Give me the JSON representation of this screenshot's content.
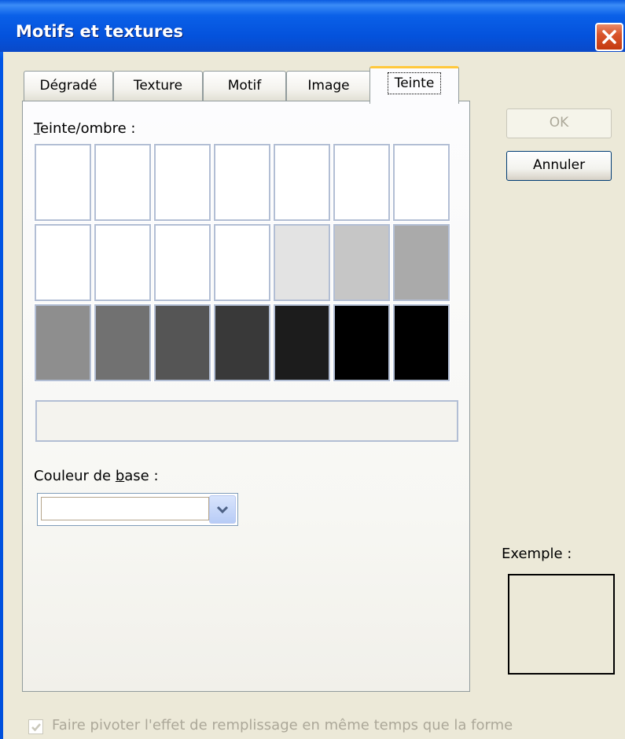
{
  "window": {
    "title": "Motifs et textures"
  },
  "tabs": [
    {
      "label": "Dégradé",
      "selected": false
    },
    {
      "label": "Texture",
      "selected": false
    },
    {
      "label": "Motif",
      "selected": false
    },
    {
      "label": "Image",
      "selected": false
    },
    {
      "label": "Teinte",
      "selected": true
    }
  ],
  "tint_panel": {
    "shade_label_prefix": "T",
    "shade_label_rest": "einte/ombre :",
    "swatch_rows": [
      [
        "#ffffff",
        "#ffffff",
        "#ffffff",
        "#ffffff",
        "#ffffff",
        "#ffffff",
        "#ffffff"
      ],
      [
        "#ffffff",
        "#ffffff",
        "#ffffff",
        "#ffffff",
        "#e3e3e3",
        "#c6c6c6",
        "#aaaaaa"
      ],
      [
        "#8e8e8e",
        "#717171",
        "#555555",
        "#393939",
        "#1c1c1c",
        "#000000",
        "#000000"
      ]
    ],
    "base_color_label_before": "Couleur de ",
    "base_color_label_underlined": "b",
    "base_color_label_after": "ase :",
    "base_color_value": ""
  },
  "buttons": {
    "ok": "OK",
    "cancel": "Annuler"
  },
  "example": {
    "label": "Exemple :"
  },
  "rotate_option": {
    "label": "Faire pivoter l'effet de remplissage en même temps que la forme",
    "checked": true,
    "disabled": true
  }
}
